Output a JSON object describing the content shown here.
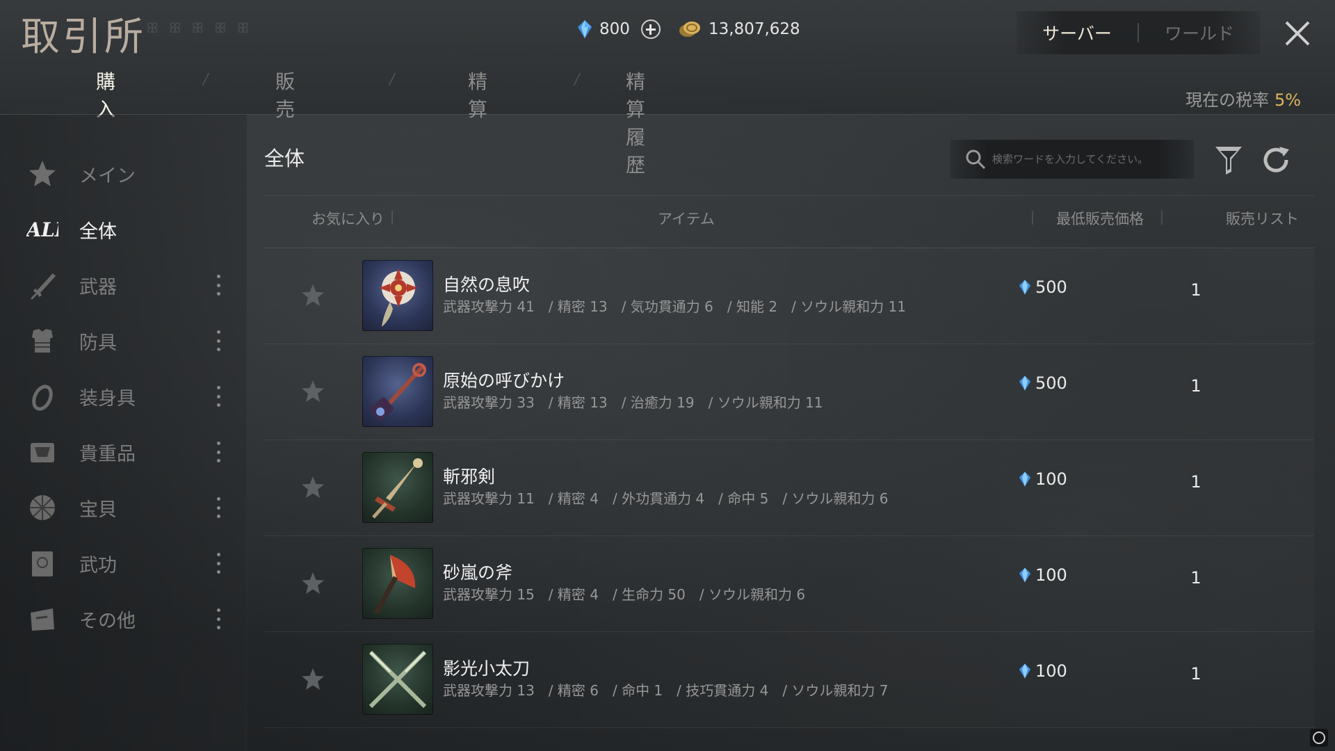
{
  "header": {
    "title": "取引所",
    "gems": "800",
    "gold": "13,807,628",
    "scope": {
      "server_label": "サーバー",
      "world_label": "ワールド"
    },
    "tax_label": "現在の税率",
    "tax_value": "5%"
  },
  "tabs": [
    {
      "label": "購入"
    },
    {
      "label": "販売"
    },
    {
      "label": "精算"
    },
    {
      "label": "精算履歴"
    }
  ],
  "sidebar": {
    "items": [
      {
        "label": "メイン",
        "icon": "star-icon"
      },
      {
        "label": "全体",
        "icon": "all-icon"
      },
      {
        "label": "武器",
        "icon": "sword-icon"
      },
      {
        "label": "防具",
        "icon": "armor-icon"
      },
      {
        "label": "装身具",
        "icon": "ring-icon"
      },
      {
        "label": "貴重品",
        "icon": "chest-icon"
      },
      {
        "label": "宝貝",
        "icon": "treasure-icon"
      },
      {
        "label": "武功",
        "icon": "book-icon"
      },
      {
        "label": "その他",
        "icon": "box-icon"
      }
    ]
  },
  "main": {
    "section_title": "全体",
    "search_placeholder": "検索ワードを入力してください。",
    "columns": {
      "favorite": "お気に入り",
      "item": "アイテム",
      "min_price": "最低販売価格",
      "listings": "販売リスト"
    },
    "rows": [
      {
        "name": "自然の息吹",
        "stats": "武器攻撃力 41　/ 精密 13　/ 気功貫通力 6　/ 知能 2　/ ソウル親和力 11",
        "price": "500",
        "listings": "1",
        "rarity_color": "#3a4670"
      },
      {
        "name": "原始の呼びかけ",
        "stats": "武器攻撃力 33　/ 精密 13　/ 治癒力 19　/ ソウル親和力 11",
        "price": "500",
        "listings": "1",
        "rarity_color": "#3a4670"
      },
      {
        "name": "斬邪剣",
        "stats": "武器攻撃力 11　/ 精密 4　/ 外功貫通力 4　/ 命中 5　/ ソウル親和力 6",
        "price": "100",
        "listings": "1",
        "rarity_color": "#2e4236"
      },
      {
        "name": "砂嵐の斧",
        "stats": "武器攻撃力 15　/ 精密 4　/ 生命力 50　/ ソウル親和力 6",
        "price": "100",
        "listings": "1",
        "rarity_color": "#2e4236"
      },
      {
        "name": "影光小太刀",
        "stats": "武器攻撃力 13　/ 精密 6　/ 命中 1　/ 技巧貫通力 4　/ ソウル親和力 7",
        "price": "100",
        "listings": "1",
        "rarity_color": "#2e4236"
      }
    ]
  },
  "colors": {
    "accent_gold": "#e0b460",
    "gem_blue": "#6fb8ff",
    "active_text": "#f2f2f2",
    "inactive_text": "#7d7d7d"
  }
}
